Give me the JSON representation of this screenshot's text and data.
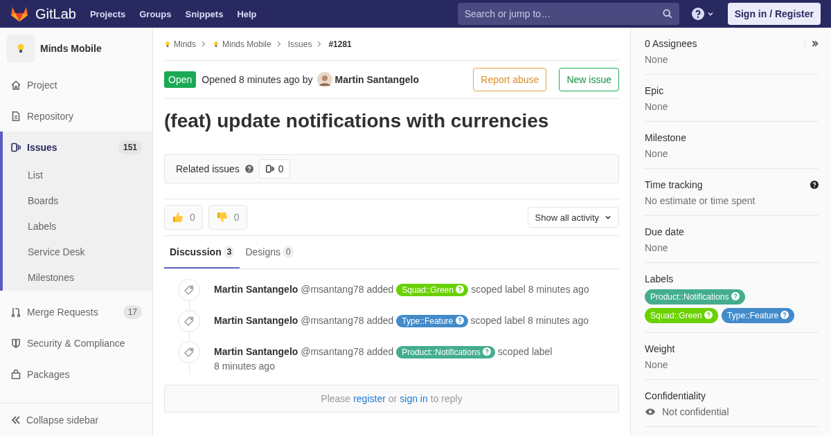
{
  "header": {
    "logo": "GitLab",
    "nav": [
      "Projects",
      "Groups",
      "Snippets",
      "Help"
    ],
    "search": {
      "placeholder": "Search or jump to…"
    },
    "sign_in": "Sign in / Register"
  },
  "sidebar": {
    "project": "Minds Mobile",
    "items": [
      {
        "label": "Project",
        "selected": false
      },
      {
        "label": "Repository",
        "selected": false
      },
      {
        "label": "Issues",
        "selected": true,
        "count": "151",
        "children": [
          {
            "label": "List",
            "selected": false
          },
          {
            "label": "Boards",
            "selected": false
          },
          {
            "label": "Labels",
            "selected": false
          },
          {
            "label": "Service Desk",
            "selected": false
          },
          {
            "label": "Milestones",
            "selected": false
          }
        ]
      },
      {
        "label": "Merge Requests",
        "selected": false,
        "count": "17"
      },
      {
        "label": "Security & Compliance",
        "selected": false
      },
      {
        "label": "Packages",
        "selected": false
      }
    ],
    "collapse": "Collapse sidebar"
  },
  "breadcrumb": [
    "Minds",
    "Minds Mobile",
    "Issues",
    "#1281"
  ],
  "issue": {
    "status": "Open",
    "opened": "Opened 8 minutes ago by",
    "author": "Martin Santangelo",
    "actions": [
      "Report abuse",
      "New issue"
    ],
    "title": "(feat) update notifications with currencies"
  },
  "related": {
    "label": "Related issues",
    "count": "0"
  },
  "awards": [
    {
      "kind": "up",
      "count": "0"
    },
    {
      "kind": "down",
      "count": "0"
    }
  ],
  "activity_filter": "Show all activity",
  "tabs": [
    {
      "label": "Discussion",
      "count": "3",
      "selected": true
    },
    {
      "label": "Designs",
      "count": "0",
      "selected": false
    }
  ],
  "notes": [
    {
      "author": "Martin Santangelo",
      "handle": "@msantang78",
      "action": "added",
      "label": {
        "text": "Squad::Green",
        "color": "#69d100"
      },
      "suffix": "scoped label",
      "time": "8 minutes ago"
    },
    {
      "author": "Martin Santangelo",
      "handle": "@msantang78",
      "action": "added",
      "label": {
        "text": "Type::Feature",
        "color": "#428bca"
      },
      "suffix": "scoped label",
      "time": "8 minutes ago"
    },
    {
      "author": "Martin Santangelo",
      "handle": "@msantang78",
      "action": "added",
      "label": {
        "text": "Product::Notifications",
        "color": "#44ad8e"
      },
      "suffix": "scoped label",
      "time": "8 minutes ago"
    }
  ],
  "reply": {
    "before": "Please",
    "register": "register",
    "middle": "or",
    "sign_in": "sign in",
    "after": "to reply"
  },
  "right_sidebar": [
    {
      "kind": "assignees",
      "title": "0 Assignees",
      "value": "None"
    },
    {
      "kind": "text",
      "title": "Epic",
      "value": "None"
    },
    {
      "kind": "text",
      "title": "Milestone",
      "value": "None"
    },
    {
      "kind": "tracking",
      "title": "Time tracking",
      "value": "No estimate or time spent"
    },
    {
      "kind": "text",
      "title": "Due date",
      "value": "None"
    },
    {
      "kind": "labels",
      "title": "Labels",
      "labels": [
        {
          "text": "Product::Notifications",
          "color": "#44ad8e"
        },
        {
          "text": "Squad::Green",
          "color": "#69d100"
        },
        {
          "text": "Type::Feature",
          "color": "#428bca"
        }
      ]
    },
    {
      "kind": "text",
      "title": "Weight",
      "value": "None"
    },
    {
      "kind": "confidential",
      "title": "Confidentiality",
      "value": "Not confidential"
    }
  ]
}
